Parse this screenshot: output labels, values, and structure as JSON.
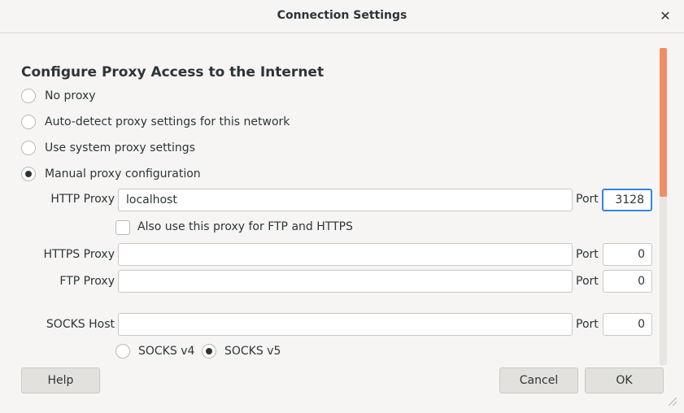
{
  "dialog": {
    "title": "Connection Settings",
    "close_icon": "close-icon"
  },
  "heading": "Configure Proxy Access to the Internet",
  "proxy_options": [
    {
      "label": "No proxy",
      "checked": false
    },
    {
      "label": "Auto-detect proxy settings for this network",
      "checked": false
    },
    {
      "label": "Use system proxy settings",
      "checked": false
    },
    {
      "label": "Manual proxy configuration",
      "checked": true
    }
  ],
  "http": {
    "label": "HTTP Proxy",
    "value": "localhost",
    "port_label": "Port",
    "port": "3128"
  },
  "also_use": {
    "label": "Also use this proxy for FTP and HTTPS",
    "checked": false
  },
  "https": {
    "label": "HTTPS Proxy",
    "value": "",
    "port_label": "Port",
    "port": "0"
  },
  "ftp": {
    "label": "FTP Proxy",
    "value": "",
    "port_label": "Port",
    "port": "0"
  },
  "socks": {
    "label": "SOCKS Host",
    "value": "",
    "port_label": "Port",
    "port": "0",
    "v4_label": "SOCKS v4",
    "v4_checked": false,
    "v5_label": "SOCKS v5",
    "v5_checked": true
  },
  "buttons": {
    "help": "Help",
    "cancel": "Cancel",
    "ok": "OK"
  },
  "colors": {
    "accent": "#3584e4",
    "scroll_thumb": "#f08e66",
    "background": "#f6f5f4"
  }
}
